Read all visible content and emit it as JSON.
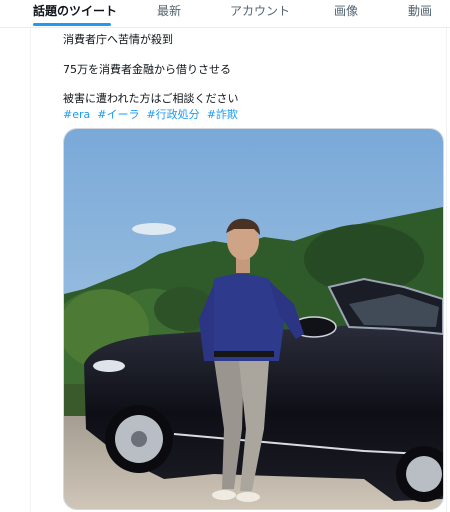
{
  "tabs": [
    {
      "label": "話題のツイート",
      "active": true
    },
    {
      "label": "最新",
      "active": false
    },
    {
      "label": "アカウント",
      "active": false
    },
    {
      "label": "画像",
      "active": false
    },
    {
      "label": "動画",
      "active": false
    }
  ],
  "tweet": {
    "line1": "消費者庁へ苦情が殺到",
    "line2": "75万を消費者金融から借りさせる",
    "line3": "被害に遭われた方はご相談ください",
    "hashtags": [
      "#era",
      "#イーラ",
      "#行政処分",
      "#詐欺"
    ]
  },
  "colors": {
    "accent": "#1d9bf0",
    "text": "#0f1419",
    "muted": "#536471"
  },
  "media": {
    "icon": "photo"
  }
}
